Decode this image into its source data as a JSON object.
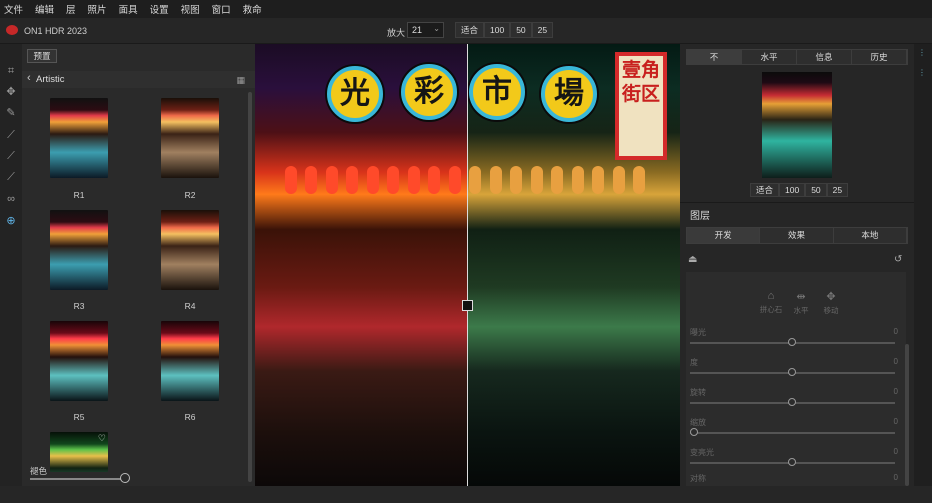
{
  "menu": [
    "文件",
    "编辑",
    "层",
    "照片",
    "面具",
    "设置",
    "视图",
    "窗口",
    "救命"
  ],
  "app": {
    "name": "ON1 HDR 2023"
  },
  "zoom": {
    "label": "放大",
    "value": "21",
    "buttons": [
      "适合",
      "100",
      "50",
      "25"
    ]
  },
  "left": {
    "preset_button": "预置",
    "category": "Artistic",
    "thumbs": [
      "R1",
      "R2",
      "R3",
      "R4",
      "R5",
      "R6"
    ],
    "strength_label": "褪色"
  },
  "canvas": {
    "signs": [
      "光",
      "彩",
      "市",
      "場"
    ],
    "vertical_sign": "壹角街区"
  },
  "right": {
    "view_tabs": [
      "不",
      "水平",
      "信息",
      "历史"
    ],
    "nav_zoom": [
      "适合",
      "100",
      "50",
      "25"
    ],
    "layers_title": "图层",
    "layer_tabs": [
      "开发",
      "效果",
      "本地"
    ],
    "adj_icons": [
      "拼心石",
      "水平",
      "移动"
    ],
    "adjust_rows": [
      {
        "label": "曝光",
        "value": "0"
      },
      {
        "label": "度",
        "value": "0"
      },
      {
        "label": "旋转",
        "value": "0"
      },
      {
        "label": "缩放",
        "value": "0"
      },
      {
        "label": "变亮光",
        "value": "0"
      },
      {
        "label": "对称",
        "value": "0"
      }
    ]
  }
}
